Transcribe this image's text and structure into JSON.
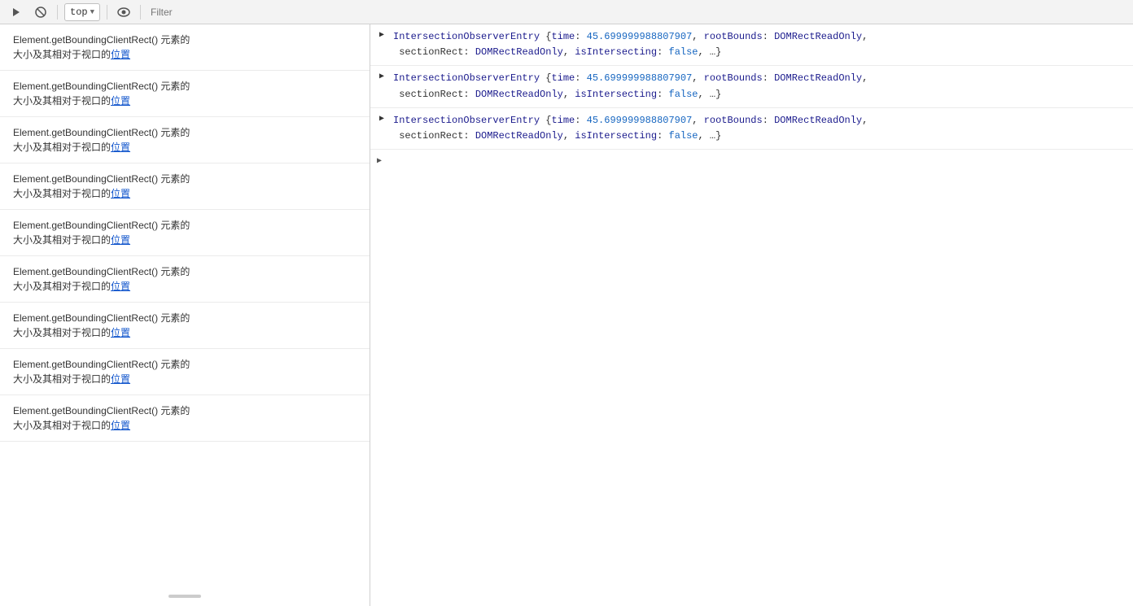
{
  "toolbar": {
    "play_label": "▶",
    "stop_label": "⊘",
    "context_label": "top",
    "eye_label": "👁",
    "filter_placeholder": "Filter"
  },
  "left_panel": {
    "items": [
      {
        "method": "Element.getBoundingClientRect()",
        "text_before": " 元素的\n大小及其相对于视口的",
        "link_text": "位置"
      },
      {
        "method": "Element.getBoundingClientRect()",
        "text_before": " 元素的\n大小及其相对于视口的",
        "link_text": "位置"
      },
      {
        "method": "Element.getBoundingClientRect()",
        "text_before": " 元素的\n大小及其相对于视口的",
        "link_text": "位置"
      },
      {
        "method": "Element.getBoundingClientRect()",
        "text_before": " 元素的\n大小及其相对于视口的",
        "link_text": "位置"
      },
      {
        "method": "Element.getBoundingClientRect()",
        "text_before": " 元素的\n大小及其相对于视口的",
        "link_text": "位置"
      },
      {
        "method": "Element.getBoundingClientRect()",
        "text_before": " 元素的\n大小及其相对于视口的",
        "link_text": "位置"
      },
      {
        "method": "Element.getBoundingClientRect()",
        "text_before": " 元素的\n大小及其相对于视口的",
        "link_text": "位置"
      },
      {
        "method": "Element.getBoundingClientRect()",
        "text_before": " 元素的\n大小及其相对于视口的",
        "link_text": "位置"
      },
      {
        "method": "Element.getBoundingClientRect()",
        "text_before": " 元素的\n大小及其相对于视口的",
        "link_text": "位置"
      }
    ]
  },
  "right_panel": {
    "entries": [
      {
        "id": 1,
        "collapsed": true,
        "line1": "IntersectionObserverEntry {time: 45.699999988807907, rootBounds: DOMRectReadOnly, ",
        "line2": "sectionRect: DOMRectReadOnly, isIntersecting: false, …}"
      },
      {
        "id": 2,
        "collapsed": true,
        "line1": "IntersectionObserverEntry {time: 45.699999988807907, rootBounds: DOMRectReadOnly, ",
        "line2": "sectionRect: DOMRectReadOnly, isIntersecting: false, …}"
      },
      {
        "id": 3,
        "collapsed": true,
        "line1": "IntersectionObserverEntry {time: 45.699999988807907, rootBounds: DOMRectReadOnly, ",
        "line2": "sectionRect: DOMRectReadOnly, isIntersecting: false, …}"
      },
      {
        "id": 4,
        "collapsed": true,
        "empty": true
      }
    ],
    "time_value": "45.699999988807907",
    "false_value": "false"
  }
}
